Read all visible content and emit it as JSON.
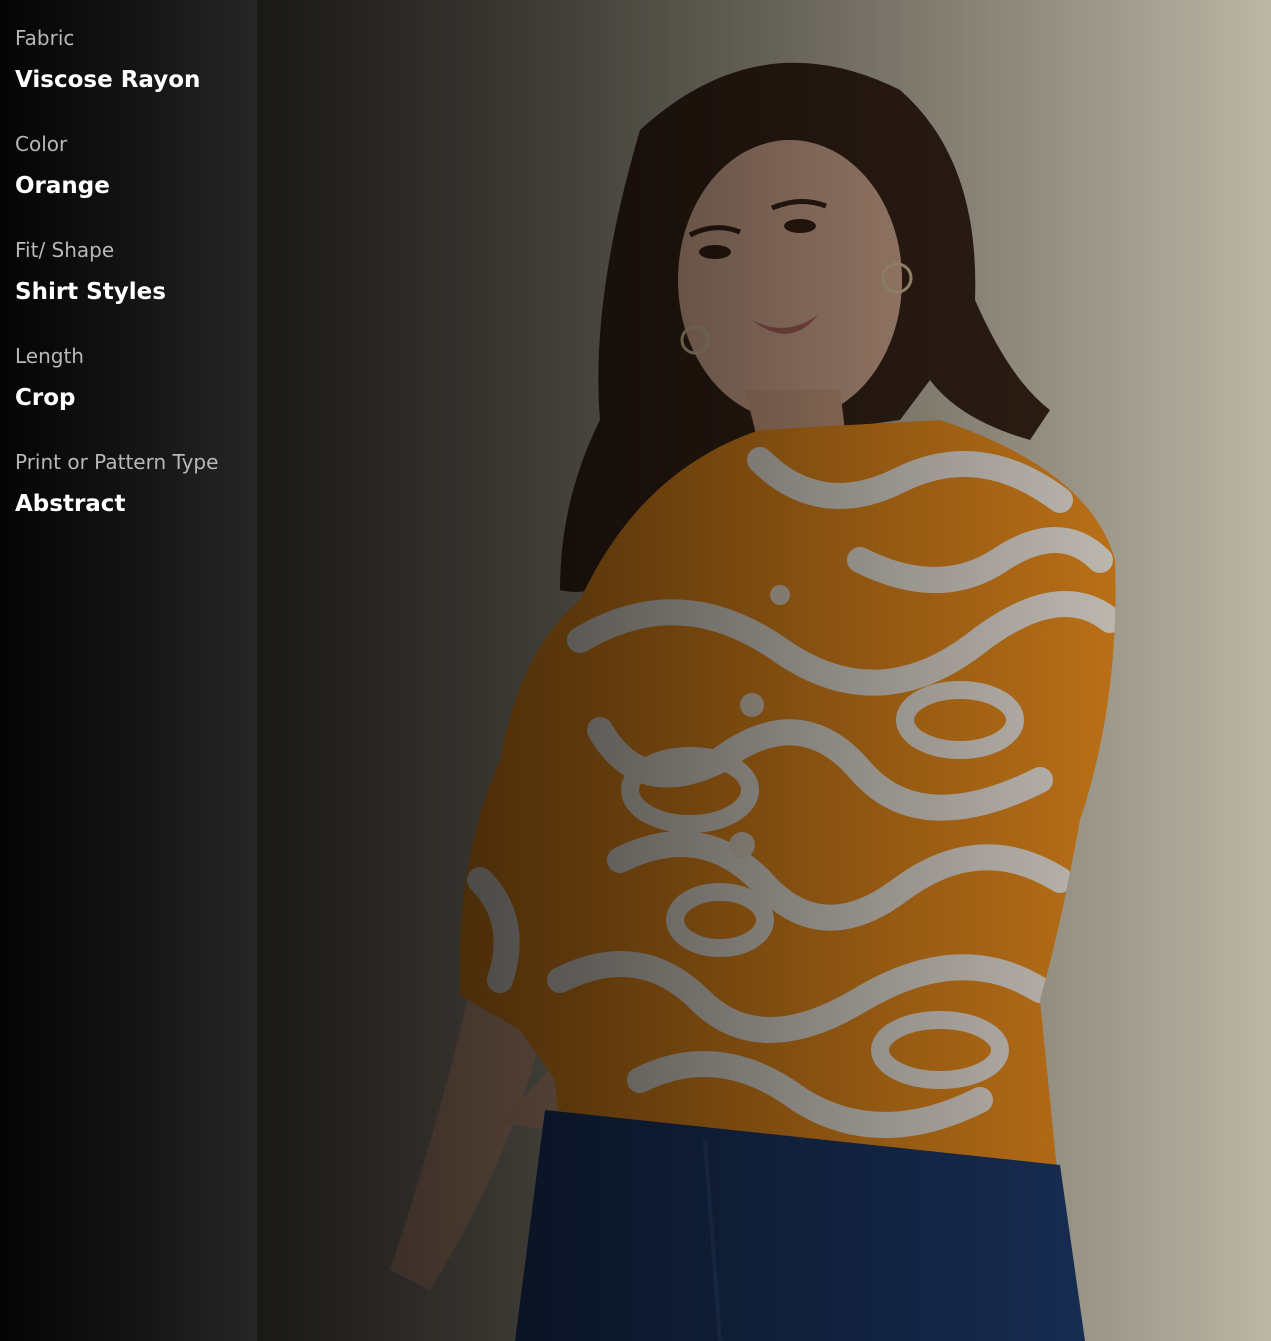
{
  "product_attributes": [
    {
      "label": "Fabric",
      "value": "Viscose Rayon"
    },
    {
      "label": "Color",
      "value": "Orange"
    },
    {
      "label": "Fit/ Shape",
      "value": "Shirt Styles"
    },
    {
      "label": "Length",
      "value": "Crop"
    },
    {
      "label": "Print or Pattern Type",
      "value": "Abstract"
    }
  ],
  "colors": {
    "shirt_orange": "#f0901e",
    "shirt_print": "#f3ece2",
    "jeans": "#1e3a6b",
    "backdrop": "#cfc7b4"
  }
}
